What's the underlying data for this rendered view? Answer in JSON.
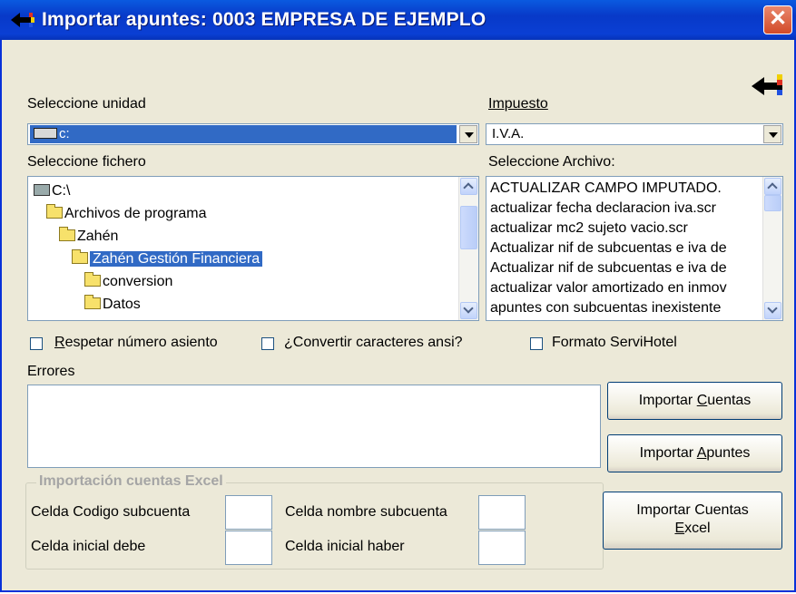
{
  "window": {
    "title": "Importar apuntes: 0003 EMPRESA DE EJEMPLO",
    "close_glyph": "✕"
  },
  "icons": {
    "title_icon": "arrow-back-icon",
    "corner_icon": "exit-arrow-icon",
    "close": "close-icon"
  },
  "unit": {
    "label": "Seleccione unidad",
    "value": "c:"
  },
  "tax": {
    "label": "Impuesto",
    "value": "I.V.A."
  },
  "file_tree": {
    "label": "Seleccione fichero",
    "items": [
      {
        "text": "C:\\",
        "indent": 0
      },
      {
        "text": "Archivos de programa",
        "indent": 1
      },
      {
        "text": "Zahén",
        "indent": 2
      },
      {
        "text": "Zahén Gestión Financiera",
        "indent": 3,
        "selected": true
      },
      {
        "text": "conversion",
        "indent": 4
      },
      {
        "text": "Datos",
        "indent": 4
      }
    ]
  },
  "file_list": {
    "label": "Seleccione Archivo:",
    "items": [
      "ACTUALIZAR CAMPO IMPUTADO.",
      "actualizar fecha declaracion iva.scr",
      "actualizar mc2 sujeto vacio.scr",
      "Actualizar nif de subcuentas e iva de",
      "Actualizar nif de subcuentas e iva de",
      "actualizar valor amortizado en inmov",
      "apuntes con subcuentas inexistente"
    ]
  },
  "options": {
    "respect_number": {
      "label_u": "R",
      "label_rest": "espetar número asiento",
      "checked": false
    },
    "convert_ansi": {
      "label": "¿Convertir caracteres ansi?",
      "checked": false
    },
    "servihotel": {
      "label": "Formato ServiHotel",
      "checked": false
    }
  },
  "errors": {
    "label": "Errores",
    "text": ""
  },
  "buttons": {
    "import_accounts": {
      "pre": "Importar ",
      "u": "C",
      "post": "uentas"
    },
    "import_entries": {
      "pre": "Importar ",
      "u": "A",
      "post": "puntes"
    },
    "import_excel": {
      "line1": "Importar Cuentas",
      "u": "E",
      "post": "xcel"
    }
  },
  "excel_group": {
    "title": "Importación cuentas Excel",
    "code_cell_label": "Celda Codigo subcuenta",
    "name_cell_label": "Celda nombre subcuenta",
    "debit_cell_label": "Celda inicial debe",
    "credit_cell_label": "Celda inicial haber",
    "code_cell_value": "",
    "name_cell_value": "",
    "debit_cell_value": "",
    "credit_cell_value": ""
  }
}
